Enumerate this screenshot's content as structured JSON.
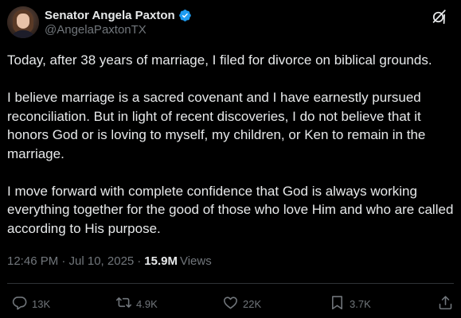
{
  "author": {
    "display_name": "Senator Angela Paxton",
    "handle": "@AngelaPaxtonTX",
    "verified": true
  },
  "post": {
    "paragraphs": [
      "Today, after 38 years of marriage, I filed for divorce on biblical grounds.",
      "I believe marriage is a sacred covenant and I have earnestly pursued reconciliation. But in light of recent discoveries, I do not believe that it honors God or is loving to myself, my children, or Ken to remain in the marriage.",
      "I move forward with complete confidence that God is always working everything together for the good of those who love Him and who are called according to His purpose."
    ],
    "timestamp": "12:46 PM · Jul 10, 2025",
    "separator": "·",
    "views_count": "15.9M",
    "views_label": "Views"
  },
  "actions": {
    "replies": "13K",
    "reposts": "4.9K",
    "likes": "22K",
    "bookmarks": "3.7K"
  },
  "colors": {
    "background": "#000000",
    "text_primary": "#e7e9ea",
    "text_secondary": "#71767b",
    "verified_badge": "#1d9bf0",
    "divider": "#2f3336"
  },
  "icons": {
    "verified": "verified-badge-icon",
    "grok": "grok-icon",
    "reply": "reply-icon",
    "repost": "repost-icon",
    "like": "heart-icon",
    "bookmark": "bookmark-icon",
    "share": "share-icon"
  }
}
